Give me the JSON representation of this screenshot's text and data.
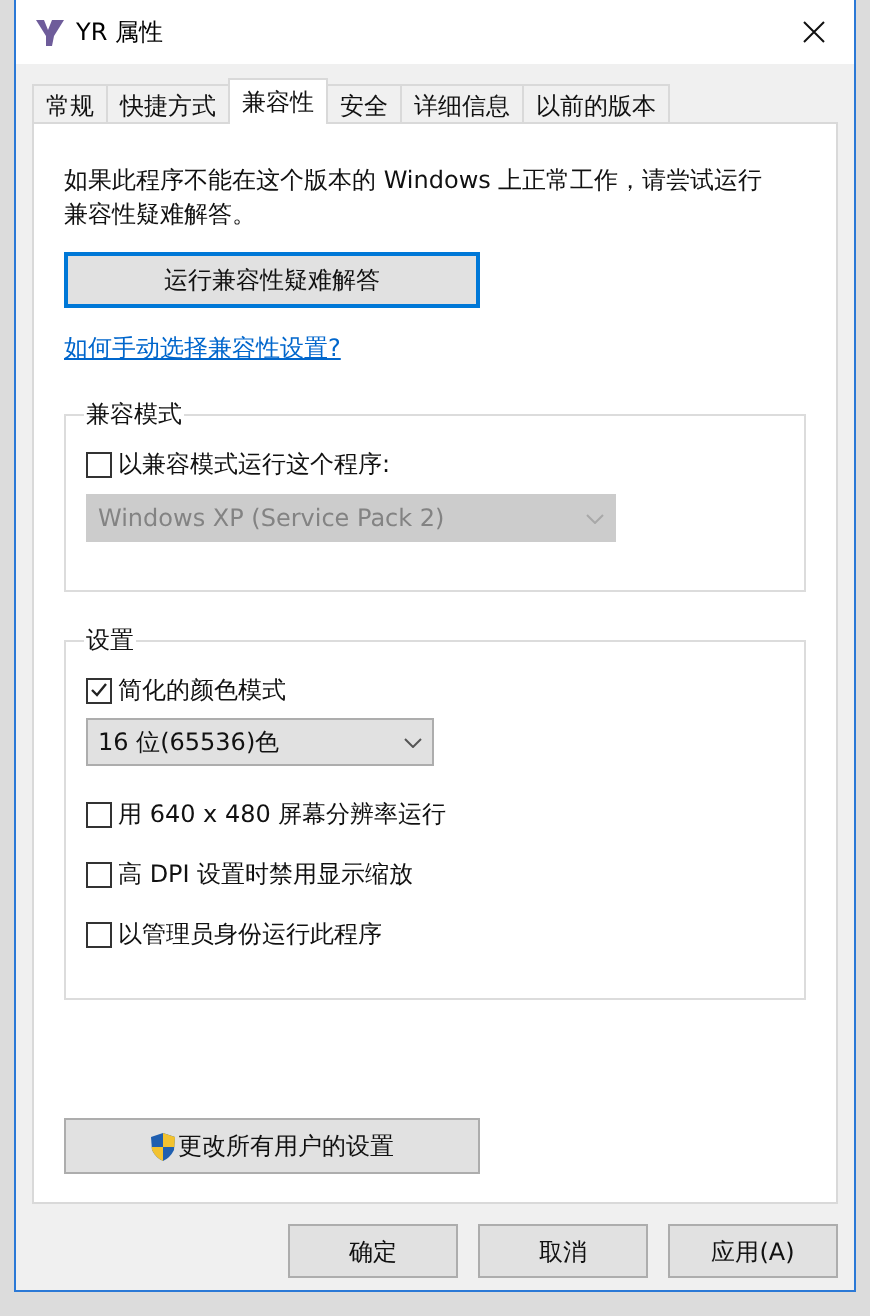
{
  "window": {
    "title": "YR 属性"
  },
  "tabs": [
    {
      "label": "常规",
      "selected": false
    },
    {
      "label": "快捷方式",
      "selected": false
    },
    {
      "label": "兼容性",
      "selected": true
    },
    {
      "label": "安全",
      "selected": false
    },
    {
      "label": "详细信息",
      "selected": false
    },
    {
      "label": "以前的版本",
      "selected": false
    }
  ],
  "description": "如果此程序不能在这个版本的 Windows 上正常工作，请尝试运行兼容性疑难解答。",
  "troubleshoot_button": "运行兼容性疑难解答",
  "help_link": "如何手动选择兼容性设置?",
  "compat_group": {
    "title": "兼容模式",
    "checkbox": {
      "label": "以兼容模式运行这个程序:",
      "checked": false
    },
    "dropdown": {
      "value": "Windows XP (Service Pack 2)",
      "disabled": true
    }
  },
  "settings_group": {
    "title": "设置",
    "items": [
      {
        "kind": "checkbox",
        "label": "简化的颜色模式",
        "checked": true
      },
      {
        "kind": "dropdown",
        "value": "16 位(65536)色",
        "disabled": false
      },
      {
        "kind": "checkbox",
        "label": "用 640 x 480 屏幕分辨率运行",
        "checked": false
      },
      {
        "kind": "checkbox",
        "label": "高 DPI 设置时禁用显示缩放",
        "checked": false
      },
      {
        "kind": "checkbox",
        "label": "以管理员身份运行此程序",
        "checked": false
      }
    ]
  },
  "all_users_button": "更改所有用户的设置",
  "footer_buttons": [
    "确定",
    "取消",
    "应用(A)"
  ]
}
